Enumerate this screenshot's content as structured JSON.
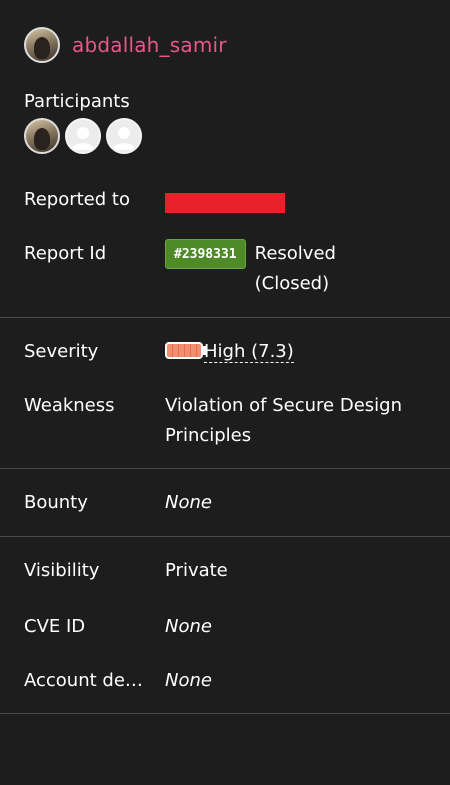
{
  "reporter": {
    "username": "abdallah_samir"
  },
  "participants": {
    "label": "Participants",
    "avatars": [
      "photo",
      "blank",
      "blank"
    ]
  },
  "details": {
    "reported_to_label": "Reported to",
    "report_id_label": "Report Id",
    "report_id": "#2398331",
    "report_status": "Resolved (Closed)",
    "severity_label": "Severity",
    "severity_value": "High (7.3)",
    "weakness_label": "Weakness",
    "weakness_value": "Violation of Secure Design Principles",
    "bounty_label": "Bounty",
    "bounty_value": "None",
    "visibility_label": "Visibility",
    "visibility_value": "Private",
    "cve_label": "CVE ID",
    "cve_value": "None",
    "account_label": "Account de…",
    "account_value": "None"
  },
  "colors": {
    "background": "#1d1d1e",
    "username": "#e8578b",
    "redaction": "#e8212a",
    "report_id_badge": "#4e8a27",
    "severity_fill": "#f09070"
  },
  "icons": {
    "blank_avatar": "default-user-icon",
    "severity": "severity-meter-icon"
  }
}
